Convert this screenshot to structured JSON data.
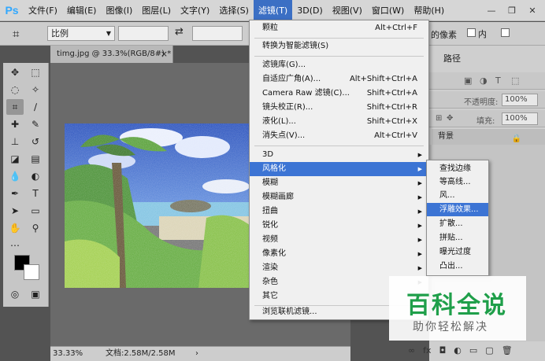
{
  "menubar": {
    "logo": "Ps",
    "items": [
      "文件(F)",
      "编辑(E)",
      "图像(I)",
      "图层(L)",
      "文字(Y)",
      "选择(S)",
      "滤镜(T)",
      "3D(D)",
      "视图(V)",
      "窗口(W)",
      "帮助(H)"
    ],
    "active_index": 6
  },
  "options": {
    "ratio_label": "比例",
    "pixels_label": "的像素",
    "content_label": "内"
  },
  "document": {
    "tab_title": "timg.jpg @ 33.3%(RGB/8#) *",
    "zoom": "33.33%",
    "doc_size": "文档:2.58M/2.58M"
  },
  "panel": {
    "tab": "路径",
    "opacity_label": "不透明度:",
    "opacity_value": "100%",
    "fill_label": "填充:",
    "fill_value": "100%",
    "layer_name": "背景"
  },
  "filter_menu": {
    "items": [
      {
        "label": "颗粒",
        "shortcut": "Alt+Ctrl+F"
      },
      {
        "label": "转换为智能滤镜(S)",
        "shortcut": ""
      },
      {
        "label": "滤镜库(G)...",
        "shortcut": ""
      },
      {
        "label": "自适应广角(A)...",
        "shortcut": "Alt+Shift+Ctrl+A"
      },
      {
        "label": "Camera Raw 滤镜(C)...",
        "shortcut": "Shift+Ctrl+A"
      },
      {
        "label": "镜头校正(R)...",
        "shortcut": "Shift+Ctrl+R"
      },
      {
        "label": "液化(L)...",
        "shortcut": "Shift+Ctrl+X"
      },
      {
        "label": "消失点(V)...",
        "shortcut": "Alt+Ctrl+V"
      },
      {
        "label": "3D",
        "shortcut": ""
      },
      {
        "label": "风格化",
        "shortcut": ""
      },
      {
        "label": "模糊",
        "shortcut": ""
      },
      {
        "label": "模糊画廊",
        "shortcut": ""
      },
      {
        "label": "扭曲",
        "shortcut": ""
      },
      {
        "label": "锐化",
        "shortcut": ""
      },
      {
        "label": "视频",
        "shortcut": ""
      },
      {
        "label": "像素化",
        "shortcut": ""
      },
      {
        "label": "渲染",
        "shortcut": ""
      },
      {
        "label": "杂色",
        "shortcut": ""
      },
      {
        "label": "其它",
        "shortcut": ""
      },
      {
        "label": "浏览联机滤镜...",
        "shortcut": ""
      }
    ]
  },
  "stylize_submenu": {
    "items": [
      "查找边缘",
      "等高线...",
      "风...",
      "浮雕效果...",
      "扩散...",
      "拼贴...",
      "曝光过度",
      "凸出..."
    ]
  },
  "watermark": {
    "title": "百科全说",
    "subtitle": "助你轻松解决"
  },
  "colors": {
    "menu_highlight": "#3c74d4",
    "ps_blue": "#31a8ff",
    "watermark_green": "#1f9f4a"
  }
}
